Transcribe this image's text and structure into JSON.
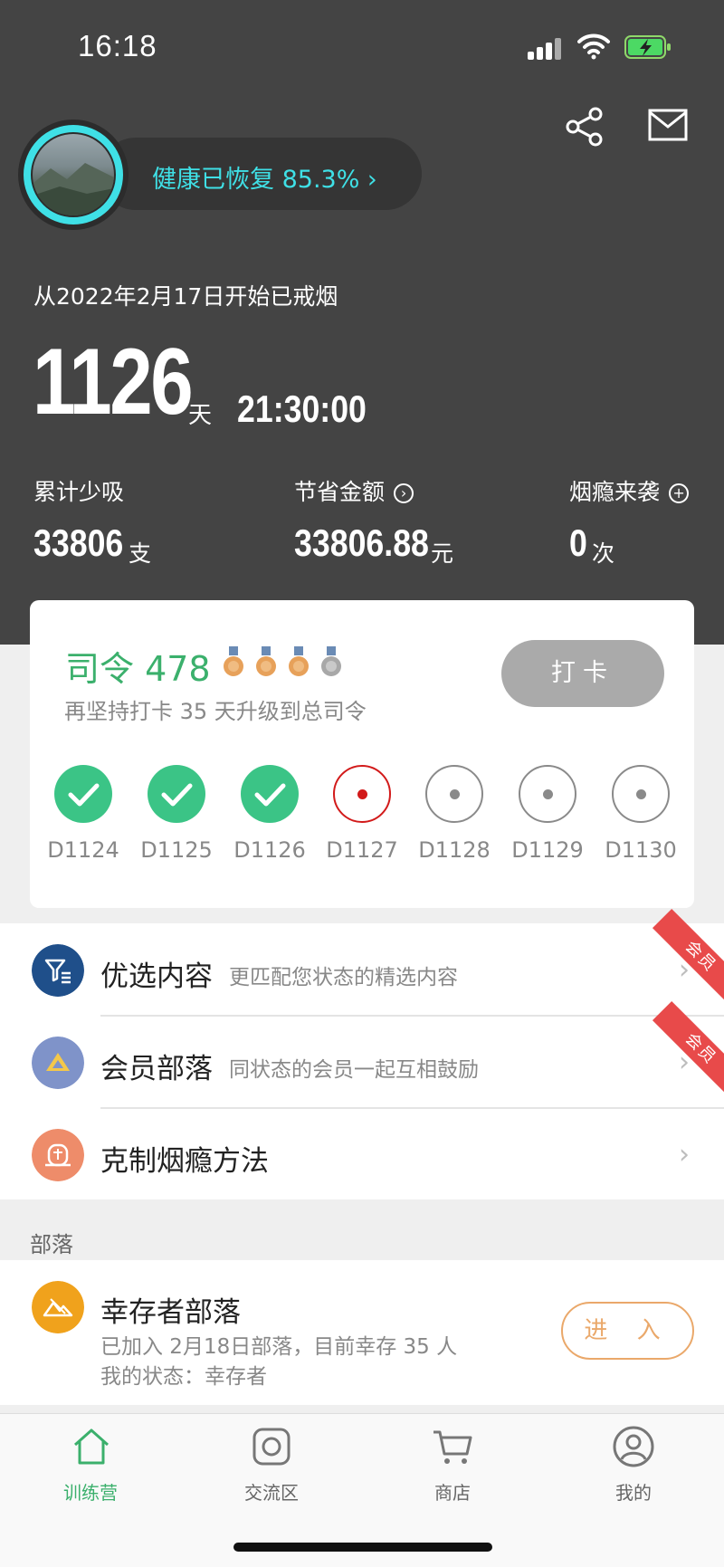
{
  "status_bar": {
    "time": "16:18"
  },
  "header": {
    "health_text": "健康已恢复 85.3% ›",
    "since_text": "从2022年2月17日开始已戒烟",
    "days": "1126",
    "days_unit": "天",
    "clock": "21:30:00",
    "stats": [
      {
        "label": "累计少吸",
        "value": "33806",
        "unit": "支",
        "icon": ""
      },
      {
        "label": "节省金额",
        "value": "33806.88",
        "unit": "元",
        "icon": "arrow-right-circle-icon"
      },
      {
        "label": "烟瘾来袭",
        "value": "0",
        "unit": "次",
        "icon": "plus-circle-icon"
      }
    ]
  },
  "checkin_card": {
    "rank": "司令 478",
    "subtitle": "再坚持打卡 35 天升级到总司令",
    "button": "打卡",
    "days": [
      "D1124",
      "D1125",
      "D1126",
      "D1127",
      "D1128",
      "D1129",
      "D1130"
    ]
  },
  "list": {
    "items": [
      {
        "title": "优选内容",
        "subtitle": "更匹配您状态的精选内容",
        "badge": "会员"
      },
      {
        "title": "会员部落",
        "subtitle": "同状态的会员一起互相鼓励",
        "badge": "会员"
      },
      {
        "title": "克制烟瘾方法",
        "subtitle": "",
        "badge": ""
      }
    ]
  },
  "section_title": "部落",
  "tribe": {
    "title": "幸存者部落",
    "line1": "已加入 2月18日部落，目前幸存 35 人",
    "line2": "我的状态：幸存者",
    "button": "进 入"
  },
  "tabbar": {
    "tabs": [
      {
        "label": "训练营",
        "icon": "home-icon",
        "active": true
      },
      {
        "label": "交流区",
        "icon": "chat-icon",
        "active": false
      },
      {
        "label": "商店",
        "icon": "cart-icon",
        "active": false
      },
      {
        "label": "我的",
        "icon": "profile-icon",
        "active": false
      }
    ]
  },
  "colors": {
    "header_bg": "#444444",
    "accent_cyan": "#3fe0e6",
    "green": "#3bb06c",
    "check_green": "#3bc486",
    "orange": "#eaa86a",
    "red": "#d21a1a"
  }
}
